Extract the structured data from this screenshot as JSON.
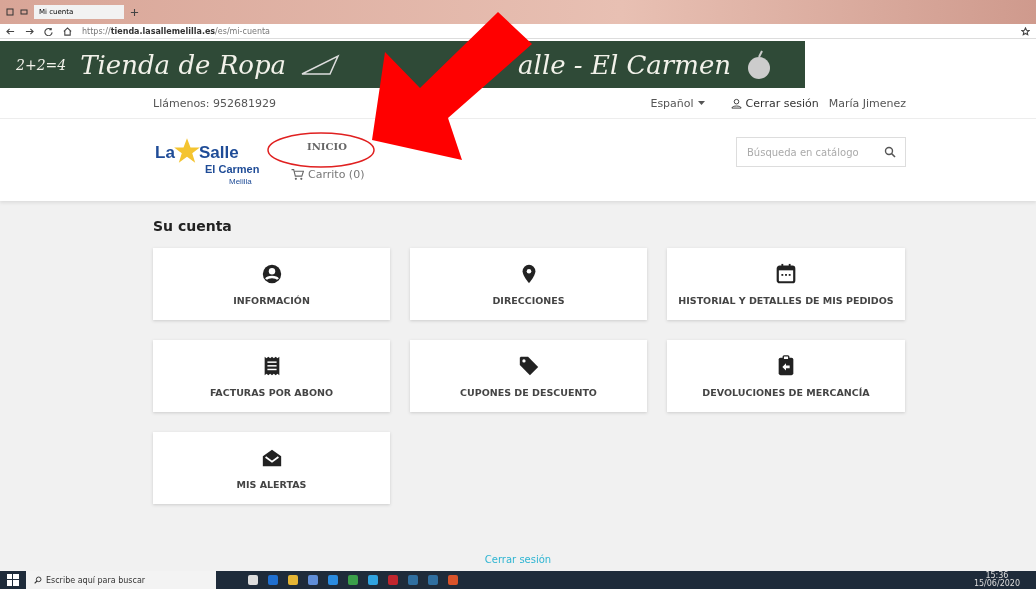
{
  "browser": {
    "tab_title": "Mi cuenta",
    "url_host": "https://tienda.lasallemelilla.es",
    "url_path": "/es/mi-cuenta"
  },
  "banner": {
    "formula": "2+2=4",
    "left_text": "Tienda de Ropa",
    "right_text": "alle - El Carmen"
  },
  "topbar": {
    "phone": "Llámenos: 952681929",
    "language": "Español",
    "logout": "Cerrar sesión",
    "user": "María Jimenez"
  },
  "logo": {
    "word1": "La",
    "word2": "Salle",
    "line2": "El Carmen",
    "line3": "Melilla"
  },
  "nav": {
    "home": "INICIO",
    "cart": "Carrito (0)"
  },
  "search": {
    "placeholder": "Búsqueda en catálogo"
  },
  "account": {
    "title": "Su cuenta",
    "cards": [
      {
        "label": "INFORMACIÓN"
      },
      {
        "label": "DIRECCIONES"
      },
      {
        "label": "HISTORIAL Y DETALLES DE MIS PEDIDOS"
      },
      {
        "label": "FACTURAS POR ABONO"
      },
      {
        "label": "CUPONES DE DESCUENTO"
      },
      {
        "label": "DEVOLUCIONES DE MERCANCÍA"
      },
      {
        "label": "MIS ALERTAS"
      }
    ]
  },
  "footer_link": "Cerrar sesión",
  "taskbar": {
    "search_placeholder": "Escribe aquí para buscar",
    "time": "15:36",
    "date": "15/06/2020"
  }
}
